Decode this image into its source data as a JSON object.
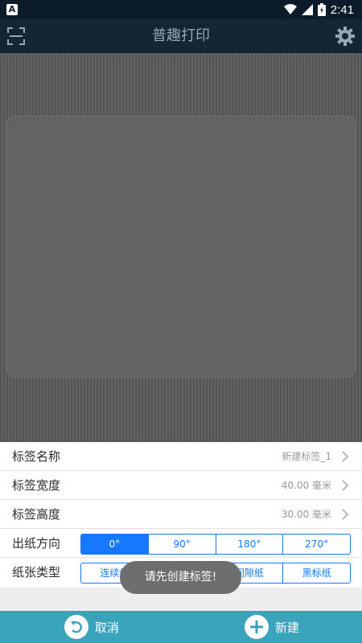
{
  "status_bar": {
    "notification_icon": "A",
    "time": "2:41",
    "icons": [
      "wifi-icon",
      "signal-icon",
      "battery-icon"
    ]
  },
  "app": {
    "title": "普趣打印",
    "left_icon": "scan-icon",
    "right_icon": "gear-icon"
  },
  "settings": {
    "label_name": {
      "label": "标签名称",
      "value": "新建标签_1"
    },
    "label_width": {
      "label": "标签宽度",
      "value": "40.00 毫米"
    },
    "label_height": {
      "label": "标签高度",
      "value": "30.00 毫米"
    },
    "direction": {
      "label": "出纸方向",
      "options": [
        "0°",
        "90°",
        "180°",
        "270°"
      ],
      "selected": "0°"
    },
    "paper_type": {
      "label": "纸张类型",
      "options": [
        "连续纸",
        "",
        "间隙纸",
        "黑标纸"
      ]
    }
  },
  "toast": "请先创建标签!",
  "bottom": {
    "cancel": "取消",
    "create": "新建"
  },
  "colors": {
    "accent": "#1677ff",
    "bottom_bar": "#3aa4bd",
    "header": "#152536"
  }
}
